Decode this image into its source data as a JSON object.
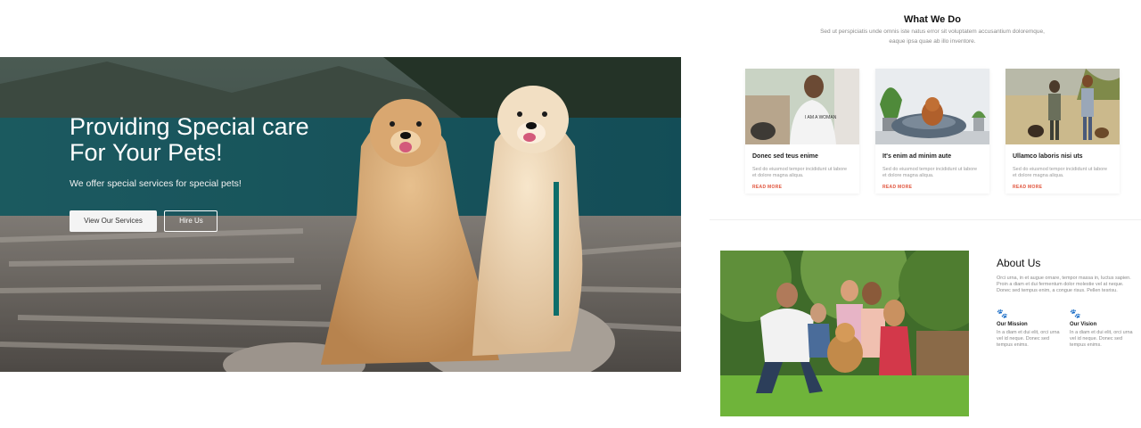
{
  "hero": {
    "title_line1": "Providing Special care",
    "title_line2_prefix": "For ",
    "title_line2_strong": "Your Pets!",
    "subtitle": "We offer special services for special pets!",
    "primary_button": "View Our Services",
    "secondary_button": "Hire Us"
  },
  "what_we_do": {
    "title": "What We Do",
    "subtitle": "Sed ut perspiciatis unde omnis iste natus error sit voluptatem accusantium doloremque, eaque ipsa quae ab illo inventore.",
    "cards": [
      {
        "title": "Donec sed teus enime",
        "text": "Sed do eiusmod tempor incididunt ut labore et dolore magna aliqua.",
        "link": "READ MORE",
        "image": "woman-with-dog-photo"
      },
      {
        "title": "It's enim ad minim aute",
        "text": "Sed do eiusmod tempor incididunt ut labore et dolore magna aliqua.",
        "link": "READ MORE",
        "image": "dog-in-pet-bed-photo"
      },
      {
        "title": "Ullamco laboris nisi uts",
        "text": "Sed do eiusmod tempor incididunt ut labore et dolore magna aliqua.",
        "link": "READ MORE",
        "image": "women-walking-dogs-photo"
      }
    ]
  },
  "about": {
    "title": "About Us",
    "text": "Orci urna, in et augue ornare, tempor massa in, luctus sapien. Proin a diam et dui fermentum dolor molestie vel at neque. Donec sed tempus enim, a congue risus. Pellen tesrisu.",
    "image": "family-with-dog-photo",
    "columns": [
      {
        "icon": "paw-icon",
        "title": "Our Mission",
        "text": "In a diam et dui elit, orci urna vel id neque. Donec sed tempus enims."
      },
      {
        "icon": "paw-icon",
        "title": "Our Vision",
        "text": "In a diam et dui elit, orci urna vel id neque. Donec sed tempus enims."
      }
    ]
  },
  "colors": {
    "accent": "#e0523a",
    "hero_overlay": "#1e4e5a"
  }
}
